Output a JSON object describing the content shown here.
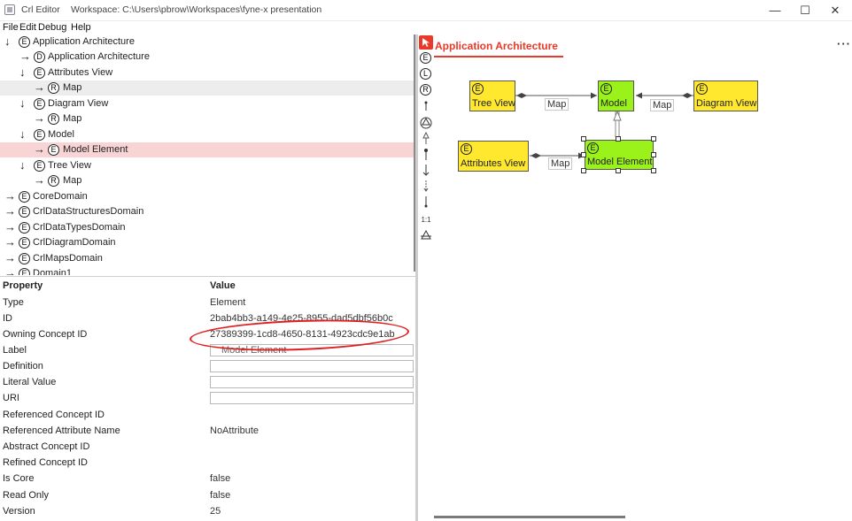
{
  "window": {
    "app_name": "Crl Editor",
    "workspace": "Workspace: C:\\Users\\pbrow\\Workspaces\\fyne-x presentation",
    "minimize": "—",
    "maximize": "☐",
    "close": "✕"
  },
  "menu": {
    "file": "File",
    "edit": "Edit",
    "debug": "Debug",
    "help": "Help"
  },
  "tree": {
    "rows": [
      {
        "expander": "↓",
        "badge": "E",
        "label": "Application Architecture"
      },
      {
        "expander": "→",
        "badge": "D",
        "label": "Application Architecture"
      },
      {
        "expander": "↓",
        "badge": "E",
        "label": "Attributes View"
      },
      {
        "expander": "→",
        "badge": "R",
        "label": "Map"
      },
      {
        "expander": "↓",
        "badge": "E",
        "label": "Diagram View"
      },
      {
        "expander": "→",
        "badge": "R",
        "label": "Map"
      },
      {
        "expander": "↓",
        "badge": "E",
        "label": "Model"
      },
      {
        "expander": "→",
        "badge": "E",
        "label": "Model Element"
      },
      {
        "expander": "↓",
        "badge": "E",
        "label": "Tree View"
      },
      {
        "expander": "→",
        "badge": "R",
        "label": "Map"
      },
      {
        "expander": "→",
        "badge": "E",
        "label": "CoreDomain"
      },
      {
        "expander": "→",
        "badge": "E",
        "label": "CrlDataStructuresDomain"
      },
      {
        "expander": "→",
        "badge": "E",
        "label": "CrlDataTypesDomain"
      },
      {
        "expander": "→",
        "badge": "E",
        "label": "CrlDiagramDomain"
      },
      {
        "expander": "→",
        "badge": "E",
        "label": "CrlMapsDomain"
      },
      {
        "expander": "→",
        "badge": "E",
        "label": "Domain1"
      }
    ]
  },
  "properties": {
    "header_property": "Property",
    "header_value": "Value",
    "rows": [
      {
        "name": "Type",
        "value": "Element"
      },
      {
        "name": "ID",
        "value": "2bab4bb3-a149-4e25-8955-dad5dbf56b0c"
      },
      {
        "name": "Owning Concept ID",
        "value": "27389399-1cd8-4650-8131-4923cdc9e1ab"
      },
      {
        "name": "Label",
        "value": "Model Element"
      },
      {
        "name": "Definition",
        "value": ""
      },
      {
        "name": "Literal Value",
        "value": ""
      },
      {
        "name": "URI",
        "value": ""
      },
      {
        "name": "Referenced Concept ID",
        "value": ""
      },
      {
        "name": "Referenced Attribute Name",
        "value": "NoAttribute"
      },
      {
        "name": "Abstract Concept ID",
        "value": ""
      },
      {
        "name": "Refined Concept ID",
        "value": ""
      },
      {
        "name": "Is Core",
        "value": "false"
      },
      {
        "name": "Read Only",
        "value": "false"
      },
      {
        "name": "Version",
        "value": "25"
      }
    ]
  },
  "diagram": {
    "tab_title": "Application Architecture",
    "tab_menu": "···",
    "toolbar": {
      "element": "E",
      "literal": "L",
      "reference": "R",
      "one_to_one": "1:1"
    },
    "nodes": [
      {
        "badge": "E",
        "label": "Tree View"
      },
      {
        "badge": "E",
        "label": "Model"
      },
      {
        "badge": "E",
        "label": "Diagram View"
      },
      {
        "badge": "E",
        "label": "Attributes View"
      },
      {
        "badge": "E",
        "label": "Model Element"
      }
    ],
    "links": [
      {
        "label": "Map"
      },
      {
        "label": "Map"
      },
      {
        "label": "Map"
      }
    ],
    "colors": {
      "accent": "#e8392a",
      "element_fill": "#ffe82e",
      "selected_fill": "#9af21a",
      "selection_row": "#f9d4d4",
      "annotation": "#e02020"
    }
  }
}
